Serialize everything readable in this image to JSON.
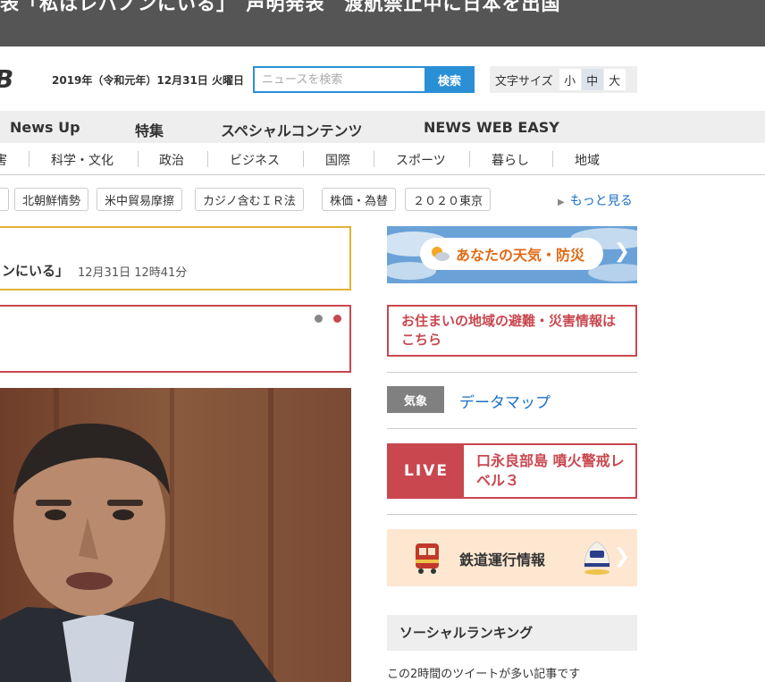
{
  "banner": {
    "text": "表「私はレバノンにいる」　声明発表　渡航禁止中に日本を出国"
  },
  "header": {
    "logo_fragment": "B",
    "date": "2019年（令和元年）12月31日 火曜日",
    "search": {
      "placeholder": "ニュースを検索",
      "button_label": "検索"
    },
    "font_size": {
      "label": "文字サイズ",
      "options": [
        "小",
        "中",
        "大"
      ],
      "selected": "中"
    }
  },
  "main_nav": {
    "items": [
      "News Up",
      "特集",
      "スペシャルコンテンツ",
      "NEWS WEB EASY"
    ]
  },
  "category_nav": {
    "items": [
      "害",
      "科学・文化",
      "政治",
      "ビジネス",
      "国際",
      "スポーツ",
      "暮らし",
      "地域"
    ]
  },
  "tags": {
    "items": [
      "北朝鮮情勢",
      "米中貿易摩擦",
      "カジノ含むＩＲ法",
      "株価・為替",
      "２０２０東京"
    ],
    "more_label": "もっと見る"
  },
  "headline": {
    "title": "ンにいる」",
    "time": "12月31日 12時41分"
  },
  "carousel": {
    "dot_colors": [
      "#888888",
      "#c9474f"
    ]
  },
  "sidebar": {
    "weather_label": "あなたの天気・防災",
    "evacuation_text": "お住まいの地域の避難・災害情報はこちら",
    "kisho_badge": "気象",
    "datamap_label": "データマップ",
    "live": {
      "label": "LIVE",
      "text": "口永良部島 噴火警戒レベル３"
    },
    "train_label": "鉄道運行情報",
    "social_heading": "ソーシャルランキング",
    "social_subtext": "この2時間のツイートが多い記事です"
  },
  "colors": {
    "accent_blue": "#2b8fd6",
    "alert_red": "#c9474f",
    "headline_gold": "#e1b23b"
  }
}
